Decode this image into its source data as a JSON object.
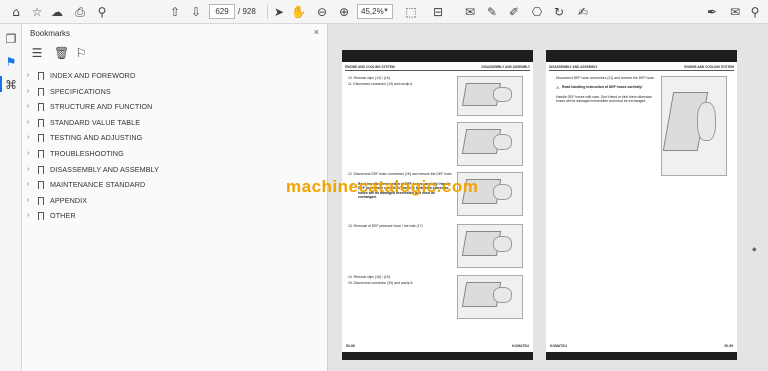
{
  "toolbar": {
    "page_current": "629",
    "page_total": "/ 928",
    "zoom_value": "45,2%",
    "left_icons": [
      "home-icon",
      "bookmark-star-icon",
      "cloud-upload-icon",
      "print-icon",
      "search-icon"
    ],
    "nav_icons": [
      "arrow-up-icon",
      "arrow-down-icon"
    ],
    "tool_icons": [
      "pointer-icon",
      "hand-icon",
      "zoom-out-icon",
      "zoom-in-icon"
    ],
    "right_icons": [
      "fit-icon",
      "scroll-mode-icon",
      "comment-icon",
      "highlight-icon",
      "draw-icon",
      "stamp-icon",
      "undo-icon",
      "sign-icon",
      "mail-icon"
    ]
  },
  "rail": {
    "icons": [
      "pages-icon",
      "bookmarks-icon",
      "attachments-icon"
    ]
  },
  "bookmarks_panel": {
    "title": "Bookmarks",
    "close_glyph": "×",
    "tool_icons": [
      "options-menu-icon",
      "delete-bookmark-icon",
      "new-bookmark-icon"
    ],
    "items": [
      {
        "label": "INDEX AND FOREWORD"
      },
      {
        "label": "SPECIFICATIONS"
      },
      {
        "label": "STRUCTURE AND FUNCTION"
      },
      {
        "label": "STANDARD VALUE TABLE"
      },
      {
        "label": "TESTING AND ADJUSTING"
      },
      {
        "label": "TROUBLESHOOTING"
      },
      {
        "label": "DISASSEMBLY AND ASSEMBLY"
      },
      {
        "label": "MAINTENANCE STANDARD"
      },
      {
        "label": "APPENDIX"
      },
      {
        "label": "OTHER"
      }
    ]
  },
  "document": {
    "left_page": {
      "header_left": "ENGINE AND COOLING SYSTEM",
      "header_right": "DISASSEMBLY AND ASSEMBLY",
      "step_10": "10. Remove clips (14) / (15).",
      "step_11": "11. Disconnect connector (13) and unclip it.",
      "step_12": "12. Disconnect DEF hose connectors (16) and remove the DEF hose.",
      "step_12_warn": "Read handling instruction of DEF hoses carefully! Handle DEF hoses with care. Don't bend or kink them otherwise hoses will be damaged irreversible and must be exchanged.",
      "step_13": "13. Removal of DEF pressure hose / hot side (17)",
      "step_14": "14. Remove clips (18) / (19).",
      "step_15": "15. Disconnect connector (20) and unclip it.",
      "footer_left": "50-98",
      "footer_right": "KOMATSU"
    },
    "right_page": {
      "header_left": "DISASSEMBLY AND ASSEMBLY",
      "header_right": "ENGINE AND COOLING SYSTEM",
      "step_16": "Disconnect DEF hose connectors (21) and remove the DEF hose.",
      "step_16_warn": "Read handling instruction of DEF hoses carefully!",
      "step_16_text": "Handle DEF hoses with care. Don't bend or kink them otherwise hoses will be damaged irreversible and must be exchanged.",
      "footer_left": "KOMATSU",
      "footer_right": "50-99"
    },
    "watermark": "machinecatalogic.com"
  }
}
